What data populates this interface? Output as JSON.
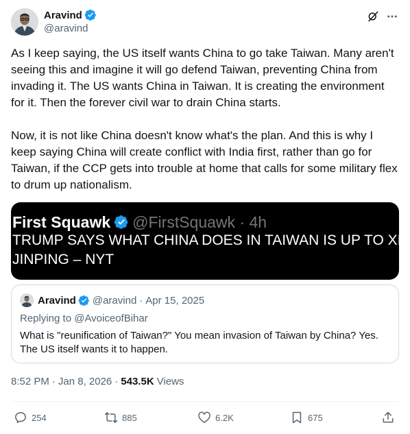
{
  "post": {
    "author_name": "Aravind",
    "author_handle": "@aravind",
    "paragraphs": [
      "As I keep saying, the US itself wants China to go take Taiwan. Many aren't seeing this and imagine it will go defend Taiwan, preventing China from invading it. The US wants China in Taiwan. It is creating the environment for it. Then the forever civil war to drain China starts.",
      "Now, it is not like China doesn't know what's the plan. And this is why I keep saying China will create conflict with India first, rather than go for Taiwan, if the CCP gets into trouble at home that calls for some military flex to drum up nationalism."
    ],
    "media": {
      "account_name": "First Squawk",
      "account_meta": "@FirstSquawk · 4h",
      "headline": "TRUMP SAYS WHAT CHINA DOES IN TAIWAN IS UP TO XI JINPING – NYT"
    },
    "quote": {
      "name": "Aravind",
      "handle": "@aravind",
      "separator": "·",
      "date": "Apr 15, 2025",
      "replying_to": "Replying to @AvoiceofBihar",
      "text": "What is \"reunification of Taiwan?\" You mean invasion of Taiwan by China? Yes. The US itself wants it to happen."
    },
    "meta": {
      "time": "8:52 PM",
      "separator": "·",
      "date": "Jan 8, 2026",
      "views_count": "543.5K",
      "views_label": "Views"
    },
    "actions": {
      "replies": "254",
      "reposts": "885",
      "likes": "6.2K",
      "bookmarks": "675"
    }
  },
  "colors": {
    "verified_blue": "#1d9bf0",
    "text_primary": "#0f1419",
    "text_secondary": "#536471",
    "media_background": "#000000",
    "border": "#cfd9de"
  },
  "icons": [
    "verified-badge-icon",
    "grok-icon",
    "more-icon",
    "reply-icon",
    "repost-icon",
    "like-icon",
    "bookmark-icon",
    "share-icon"
  ]
}
